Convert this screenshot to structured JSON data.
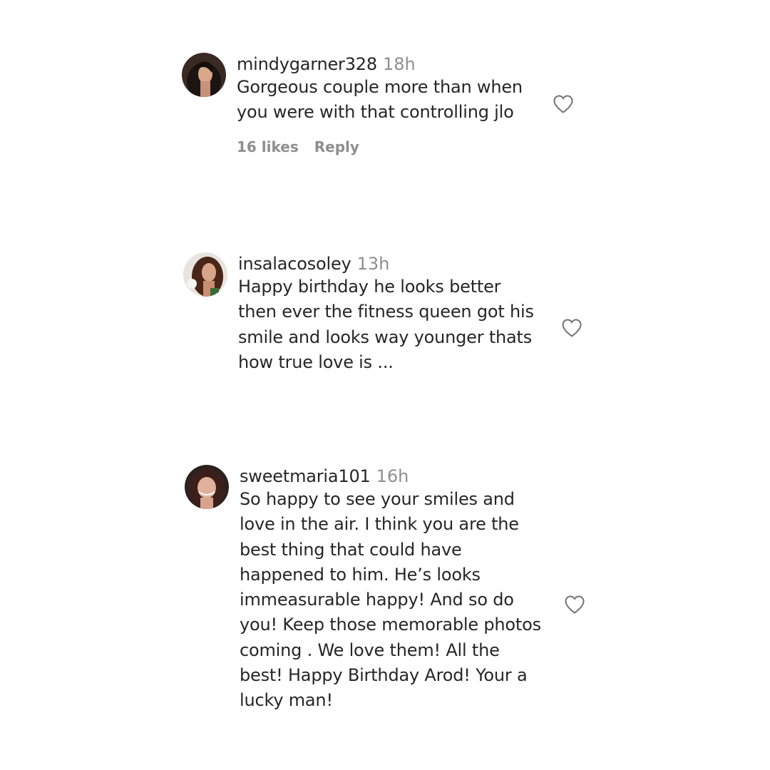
{
  "comments": [
    {
      "username": "mindygarner328",
      "time": "18h",
      "text": "Gorgeous couple more than when\nyou were with that controlling jlo",
      "likes": "16 likes",
      "reply": "Reply"
    },
    {
      "username": "insalacosoley",
      "time": "13h",
      "text": "Happy birthday he looks better\nthen ever the fitness queen got his\nsmile and looks way younger thats\nhow true love is ..."
    },
    {
      "username": "sweetmaria101",
      "time": "16h",
      "text": "So happy to see your smiles and\nlove in the air. I think you are the\nbest thing that could have\nhappened to him. He’s looks\nimmeasurable happy! And so do\nyou! Keep those memorable photos\ncoming . We love them! All the\nbest! Happy Birthday Arod! Your a\nlucky man!"
    }
  ],
  "icons": {
    "like": "heart-outline-icon",
    "avatar": "profile-photo"
  },
  "colors": {
    "text": "#262626",
    "muted": "#8e8e8e",
    "background": "#ffffff"
  }
}
